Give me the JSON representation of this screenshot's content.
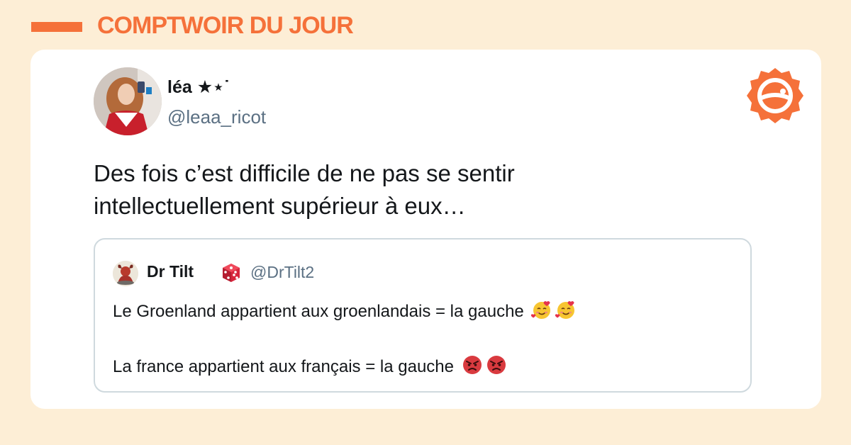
{
  "banner": {
    "title": "COMPTWOIR DU JOUR",
    "accent_color": "#f5713a"
  },
  "tweet": {
    "author": {
      "display_name": "léa ★⋆˙",
      "handle": "@leaa_ricot",
      "avatar_icon": "profile-photo"
    },
    "text_lines": [
      "Des fois c’est difficile de ne pas se sentir",
      "intellectuellement supérieur à eux…"
    ],
    "brand_icon": "comptwoir-logo-icon"
  },
  "quoted_tweet": {
    "author": {
      "display_name": "Dr Tilt",
      "name_emoji": "game-die-icon",
      "handle": "@DrTilt2",
      "avatar_icon": "bull-avatar"
    },
    "lines": [
      {
        "text": "Le Groenland appartient aux groenlandais = la gauche",
        "emoji": "smiling-face-with-hearts-icon",
        "emoji_count": 2
      },
      {
        "text": "La france appartient aux français = la gauche",
        "emoji": "angry-face-icon",
        "emoji_count": 2
      }
    ]
  }
}
